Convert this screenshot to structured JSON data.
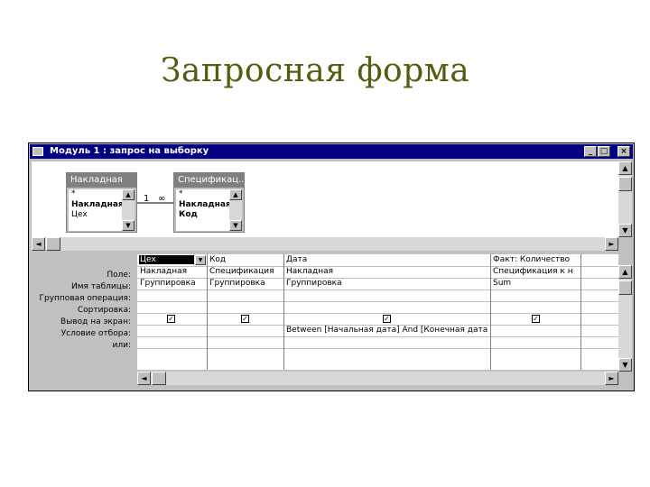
{
  "slide": {
    "title": "Запросная форма"
  },
  "window": {
    "title": "Модуль 1 : запрос на выборку",
    "minimize": "_",
    "maximize": "□",
    "close": "×"
  },
  "tables": [
    {
      "name": "Накладная",
      "fields": [
        "*",
        "Накладная№",
        "Цех"
      ]
    },
    {
      "name": "Спецификац...",
      "fields": [
        "*",
        "Накладная№",
        "Код"
      ]
    }
  ],
  "relation": {
    "one": "1",
    "many": "∞"
  },
  "row_labels": [
    "Поле:",
    "Имя таблицы:",
    "Групповая операция:",
    "Сортировка:",
    "Вывод на экран:",
    "Условие отбора:",
    "или:"
  ],
  "columns": [
    {
      "field": "Цех",
      "table": "Накладная",
      "group": "Группировка",
      "sort": "",
      "show": true,
      "criteria": ""
    },
    {
      "field": "Код",
      "table": "Спецификация",
      "group": "Группировка",
      "sort": "",
      "show": true,
      "criteria": ""
    },
    {
      "field": "Дата",
      "table": "Накладная",
      "group": "Группировка",
      "sort": "",
      "show": true,
      "criteria": "Between [Начальная дата] And [Конечная дата]"
    },
    {
      "field": "Факт: Количество",
      "table": "Спецификация к н",
      "group": "Sum",
      "sort": "",
      "show": true,
      "criteria": ""
    }
  ],
  "icons": {
    "checkbox": "check-icon",
    "scroll_up": "arrow-up-icon",
    "scroll_down": "arrow-down-icon",
    "scroll_left": "arrow-left-icon",
    "scroll_right": "arrow-right-icon",
    "dropdown": "chevron-down-icon"
  },
  "glyphs": {
    "up": "▲",
    "down": "▼",
    "left": "◄",
    "right": "►",
    "check": "✓"
  },
  "colors": {
    "titlebar": "#000080",
    "window": "#c0c0c0",
    "slide_title": "#5a5a10"
  }
}
